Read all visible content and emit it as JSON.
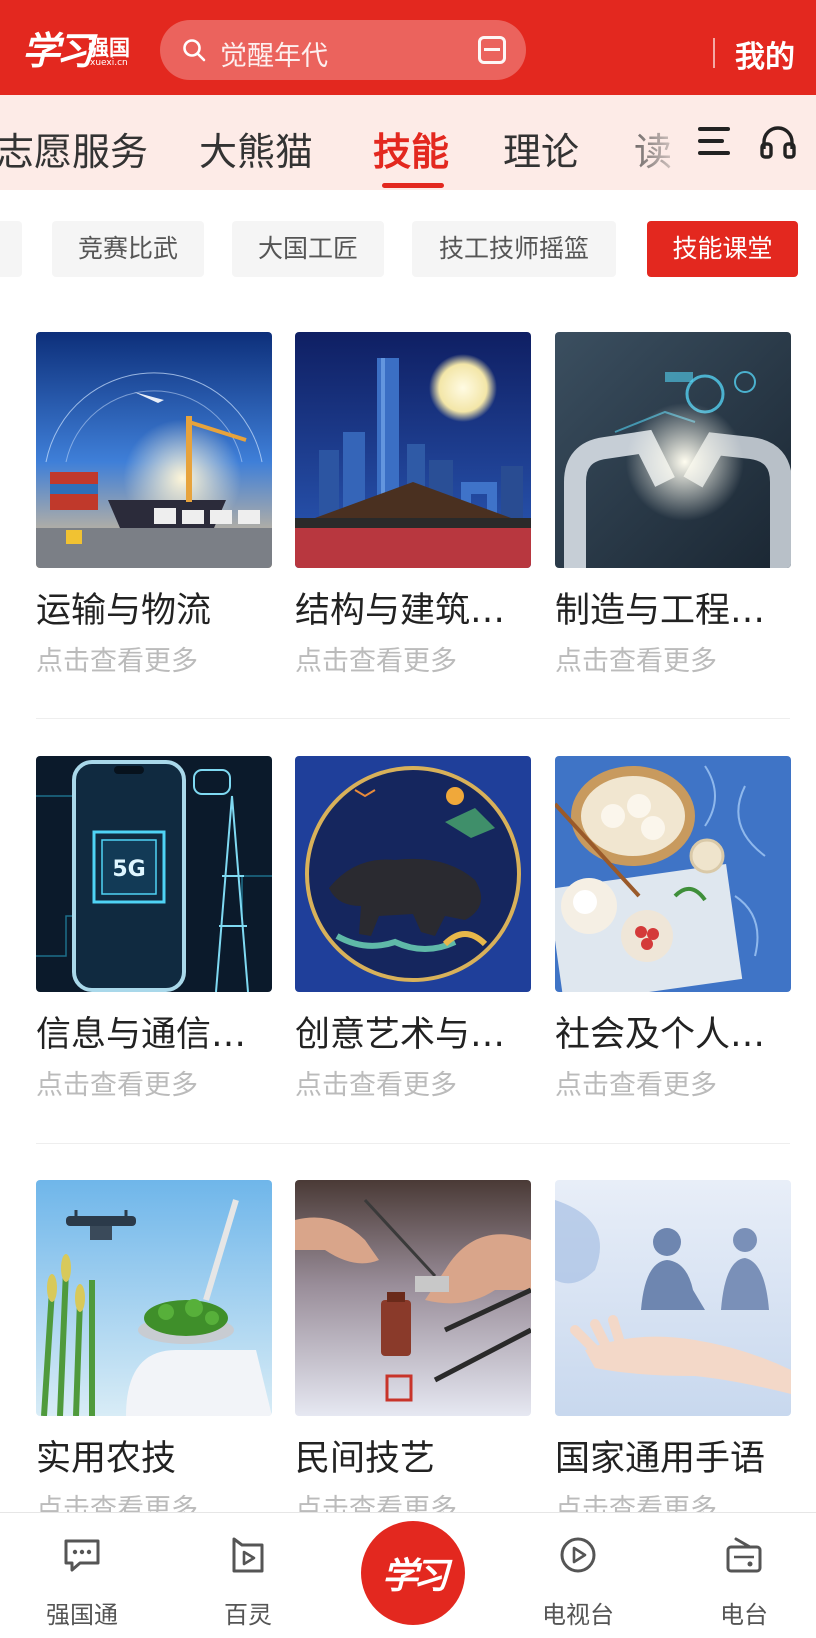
{
  "header": {
    "logo_mark": "学习",
    "logo_brand": "强国",
    "logo_domain": "xuexi.cn",
    "search_placeholder": "觉醒年代",
    "mine_label": "我的"
  },
  "tabs": [
    "志愿服务",
    "大熊猫",
    "技能",
    "理论",
    "读"
  ],
  "sub_tags": [
    "竞赛比武",
    "大国工匠",
    "技工技师摇篮",
    "技能课堂"
  ],
  "cards": [
    {
      "title": "运输与物流",
      "subtitle": "点击查看更多"
    },
    {
      "title": "结构与建筑…",
      "subtitle": "点击查看更多"
    },
    {
      "title": "制造与工程…",
      "subtitle": "点击查看更多"
    },
    {
      "title": "信息与通信…",
      "subtitle": "点击查看更多"
    },
    {
      "title": "创意艺术与…",
      "subtitle": "点击查看更多"
    },
    {
      "title": "社会及个人…",
      "subtitle": "点击查看更多"
    },
    {
      "title": "实用农技",
      "subtitle": "点击查看更多"
    },
    {
      "title": "民间技艺",
      "subtitle": "点击查看更多"
    },
    {
      "title": "国家通用手语",
      "subtitle": "点击查看更多"
    }
  ],
  "thumb_text": {
    "fiveg": "5G"
  },
  "bottom_nav": [
    "强国通",
    "百灵",
    "电视台",
    "电台"
  ],
  "center_button": "学习",
  "colors": {
    "brand_red": "#e3281f",
    "tab_bar_bg": "#fdebe7",
    "chip_bg": "#f5f5f5",
    "muted_text": "#bbbbbb"
  }
}
